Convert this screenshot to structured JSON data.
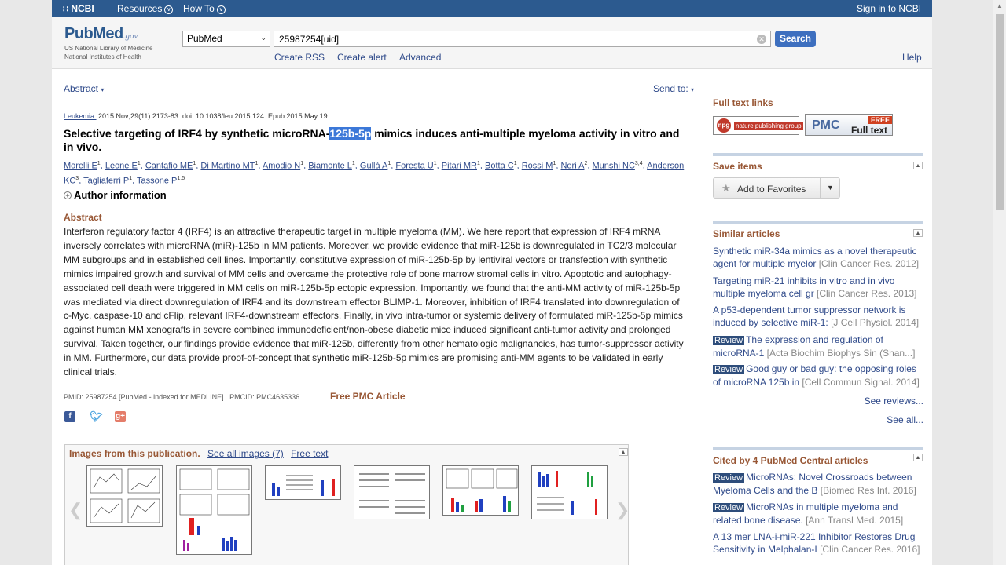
{
  "ncbi_bar": {
    "logo": "NCBI",
    "resources": "Resources",
    "howto": "How To",
    "signin": "Sign in to NCBI"
  },
  "header": {
    "logo_main": "PubMed",
    "logo_gov": ".gov",
    "logo_sub1": "US National Library of Medicine",
    "logo_sub2": "National Institutes of Health",
    "db_select": "PubMed",
    "search_value": "25987254[uid]",
    "search_button": "Search",
    "create_rss": "Create RSS",
    "create_alert": "Create alert",
    "advanced": "Advanced",
    "help": "Help"
  },
  "toolbar": {
    "format": "Abstract",
    "send_to": "Send to:"
  },
  "article": {
    "journal": "Leukemia.",
    "citation": " 2015 Nov;29(11):2173-83. doi: 10.1038/leu.2015.124. Epub 2015 May 19.",
    "title_before": "Selective targeting of IRF4 by synthetic microRNA-",
    "title_highlight": "125b-5p",
    "title_after": " mimics induces anti-multiple myeloma activity in vitro and in vivo.",
    "authors": [
      {
        "name": "Morelli E",
        "sup": "1"
      },
      {
        "name": "Leone E",
        "sup": "1"
      },
      {
        "name": "Cantafio ME",
        "sup": "1"
      },
      {
        "name": "Di Martino MT",
        "sup": "1"
      },
      {
        "name": "Amodio N",
        "sup": "1"
      },
      {
        "name": "Biamonte L",
        "sup": "1"
      },
      {
        "name": "Gullà A",
        "sup": "1"
      },
      {
        "name": "Foresta U",
        "sup": "1"
      },
      {
        "name": "Pitari MR",
        "sup": "1"
      },
      {
        "name": "Botta C",
        "sup": "1"
      },
      {
        "name": "Rossi M",
        "sup": "1"
      },
      {
        "name": "Neri A",
        "sup": "2"
      },
      {
        "name": "Munshi NC",
        "sup": "3,4"
      },
      {
        "name": "Anderson KC",
        "sup": "3"
      },
      {
        "name": "Tagliaferri P",
        "sup": "1"
      },
      {
        "name": "Tassone P",
        "sup": "1,5"
      }
    ],
    "author_info": "Author information",
    "abstract_heading": "Abstract",
    "abstract_text": "Interferon regulatory factor 4 (IRF4) is an attractive therapeutic target in multiple myeloma (MM). We here report that expression of IRF4 mRNA inversely correlates with microRNA (miR)-125b in MM patients. Moreover, we provide evidence that miR-125b is downregulated in TC2/3 molecular MM subgroups and in established cell lines. Importantly, constitutive expression of miR-125b-5p by lentiviral vectors or transfection with synthetic mimics impaired growth and survival of MM cells and overcame the protective role of bone marrow stromal cells in vitro. Apoptotic and autophagy-associated cell death were triggered in MM cells on miR-125b-5p ectopic expression. Importantly, we found that the anti-MM activity of miR-125b-5p was mediated via direct downregulation of IRF4 and its downstream effector BLIMP-1. Moreover, inhibition of IRF4 translated into downregulation of c-Myc, caspase-10 and cFlip, relevant IRF4-downstream effectors. Finally, in vivo intra-tumor or systemic delivery of formulated miR-125b-5p mimics against human MM xenografts in severe combined immunodeficient/non-obese diabetic mice induced significant anti-tumor activity and prolonged survival. Taken together, our findings provide evidence that miR-125b, differently from other hematologic malignancies, has tumor-suppressor activity in MM. Furthermore, our data provide proof-of-concept that synthetic miR-125b-5p mimics are promising anti-MM agents to be validated in early clinical trials.",
    "pmid_line": "PMID: 25987254 [PubMed - indexed for MEDLINE]   PMCID: PMC4635336",
    "free_pmc": "Free PMC Article"
  },
  "images": {
    "heading": "Images from this publication.",
    "see_all": "See all images (7)",
    "free_text": "Free text"
  },
  "sidebar": {
    "full_text_links": "Full text links",
    "npg_label": "nature publishing group",
    "pmc_label": "PMC",
    "pmc_free": "FREE",
    "pmc_full": "Full text",
    "save_items": "Save items",
    "add_favorites": "Add to Favorites",
    "similar_heading": "Similar articles",
    "similar": [
      {
        "review": "",
        "text": "Synthetic miR-34a mimics as a novel therapeutic agent for multiple myelor",
        "journal": "[Clin Cancer Res. 2012]"
      },
      {
        "review": "",
        "text": "Targeting miR-21 inhibits in vitro and in vivo multiple myeloma cell gr",
        "journal": "[Clin Cancer Res. 2013]"
      },
      {
        "review": "",
        "text": "A p53-dependent tumor suppressor network is induced by selective miR-1:",
        "journal": "[J Cell Physiol. 2014]"
      },
      {
        "review": "Review",
        "text": "The expression and regulation of microRNA-1",
        "journal": "[Acta Biochim Biophys Sin (Shan...]"
      },
      {
        "review": "Review",
        "text": "Good guy or bad guy: the opposing roles of microRNA 125b in",
        "journal": "[Cell Commun Signal. 2014]"
      }
    ],
    "see_reviews": "See reviews...",
    "see_all": "See all...",
    "cited_heading": "Cited by 4 PubMed Central articles",
    "cited": [
      {
        "review": "Review",
        "text": "MicroRNAs: Novel Crossroads between Myeloma Cells and the B",
        "journal": "[Biomed Res Int. 2016]"
      },
      {
        "review": "Review",
        "text": "MicroRNAs in multiple myeloma and related bone disease.",
        "journal": "[Ann Transl Med. 2015]"
      },
      {
        "review": "",
        "text": "A 13 mer LNA-i-miR-221 Inhibitor Restores Drug Sensitivity in Melphalan-I",
        "journal": "[Clin Cancer Res. 2016]"
      }
    ]
  }
}
